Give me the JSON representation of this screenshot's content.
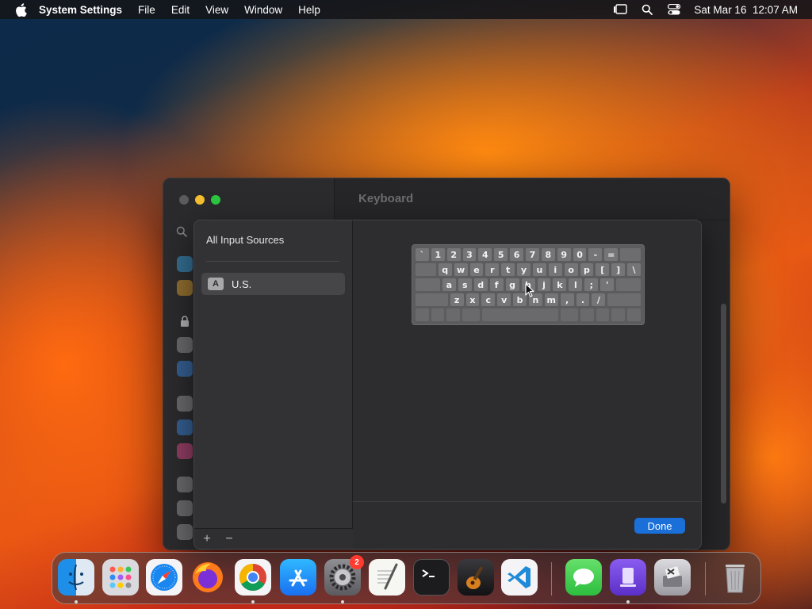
{
  "menubar": {
    "app_name": "System Settings",
    "items": [
      "File",
      "Edit",
      "View",
      "Window",
      "Help"
    ],
    "clock": "Sat Mar 16  12:07 AM"
  },
  "window": {
    "title": "Keyboard"
  },
  "sheet": {
    "section_title": "All Input Sources",
    "source": {
      "badge": "A",
      "label": "U.S."
    },
    "add_label": "+",
    "remove_label": "−",
    "done_label": "Done"
  },
  "keyboard": {
    "row1": [
      "`",
      "1",
      "2",
      "3",
      "4",
      "5",
      "6",
      "7",
      "8",
      "9",
      "0",
      "-",
      "="
    ],
    "row2": [
      "q",
      "w",
      "e",
      "r",
      "t",
      "y",
      "u",
      "i",
      "o",
      "p",
      "[",
      "]",
      "\\"
    ],
    "row3": [
      "a",
      "s",
      "d",
      "f",
      "g",
      "h",
      "j",
      "k",
      "l",
      ";",
      "'"
    ],
    "row4": [
      "z",
      "x",
      "c",
      "v",
      "b",
      "n",
      "m",
      ",",
      ".",
      "/"
    ]
  },
  "dock": {
    "system_settings_badge": "2"
  },
  "colors": {
    "accent": "#1a6fd9",
    "window_bg": "#262628",
    "badge_red": "#ff3b30"
  }
}
